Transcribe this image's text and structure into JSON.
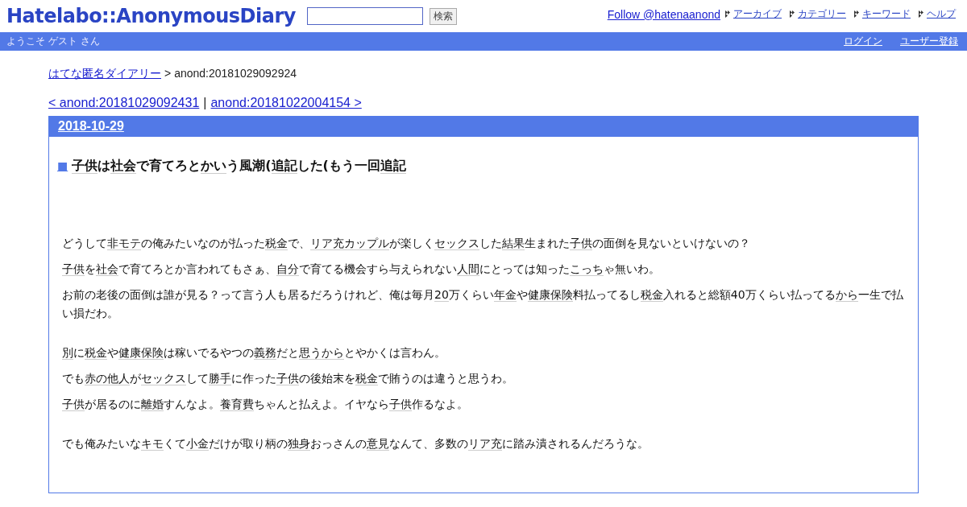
{
  "header": {
    "logo": "Hatelabo::AnonymousDiary",
    "search": {
      "button": "検索"
    },
    "follow": "Follow @hatenaanond",
    "nav": [
      "アーカイブ",
      "カテゴリー",
      "キーワード",
      "ヘルプ"
    ]
  },
  "userbar": {
    "welcome": "ようこそ ゲスト さん",
    "links": [
      "ログイン",
      "ユーザー登録"
    ]
  },
  "breadcrumb": {
    "home": "はてな匿名ダイアリー",
    "separator": ">",
    "current": "anond:20181029092924"
  },
  "pager": {
    "prev": "< anond:20181029092431",
    "separator": "|",
    "next": "anond:20181022004154 >"
  },
  "entry": {
    "date": "2018-10-29",
    "mark": "■",
    "title": [
      {
        "text": "子供",
        "keyword": true
      },
      {
        "text": "は",
        "keyword": false
      },
      {
        "text": "社会",
        "keyword": true
      },
      {
        "text": "で育てろと",
        "keyword": false
      },
      {
        "text": "かい",
        "keyword": true
      },
      {
        "text": "う風潮(",
        "keyword": false
      },
      {
        "text": "追記",
        "keyword": true
      },
      {
        "text": "した(もう一回",
        "keyword": false
      },
      {
        "text": "追記",
        "keyword": true
      }
    ],
    "sections": [
      [
        [
          {
            "text": "どうして",
            "keyword": false
          },
          {
            "text": "非モテ",
            "keyword": true
          },
          {
            "text": "の俺みたいなのが払った",
            "keyword": false
          },
          {
            "text": "税金",
            "keyword": true
          },
          {
            "text": "で、",
            "keyword": false
          },
          {
            "text": "リア充カップル",
            "keyword": true
          },
          {
            "text": "が楽しく",
            "keyword": false
          },
          {
            "text": "セックス",
            "keyword": true
          },
          {
            "text": "した",
            "keyword": false
          },
          {
            "text": "結果",
            "keyword": true
          },
          {
            "text": "生まれた",
            "keyword": false
          },
          {
            "text": "子供",
            "keyword": true
          },
          {
            "text": "の面倒を見ないといけないの？",
            "keyword": false
          }
        ],
        [
          {
            "text": "子供",
            "keyword": true
          },
          {
            "text": "を",
            "keyword": false
          },
          {
            "text": "社会",
            "keyword": true
          },
          {
            "text": "で育てろとか言われてもさぁ、",
            "keyword": false
          },
          {
            "text": "自分",
            "keyword": true
          },
          {
            "text": "で育てる機会すら与えられない",
            "keyword": false
          },
          {
            "text": "人間",
            "keyword": true
          },
          {
            "text": "にとっては知った",
            "keyword": false
          },
          {
            "text": "こっち",
            "keyword": true
          },
          {
            "text": "ゃ無いわ。",
            "keyword": false
          }
        ],
        [
          {
            "text": "お前の老後の面倒は誰が見る？って言う人も居るだろうけれど、俺は毎月",
            "keyword": false
          },
          {
            "text": "20",
            "keyword": true
          },
          {
            "text": "万くらい",
            "keyword": false
          },
          {
            "text": "年金",
            "keyword": true
          },
          {
            "text": "や",
            "keyword": false
          },
          {
            "text": "健康保険",
            "keyword": true
          },
          {
            "text": "料払ってるし",
            "keyword": false
          },
          {
            "text": "税金",
            "keyword": true
          },
          {
            "text": "入れると総額40万くらい払ってる",
            "keyword": false
          },
          {
            "text": "から",
            "keyword": true
          },
          {
            "text": "一生で払い損だわ。",
            "keyword": false
          }
        ]
      ],
      [
        [
          {
            "text": "別",
            "keyword": true
          },
          {
            "text": "に",
            "keyword": false
          },
          {
            "text": "税金",
            "keyword": true
          },
          {
            "text": "や",
            "keyword": false
          },
          {
            "text": "健康保険",
            "keyword": true
          },
          {
            "text": "は稼いでるやつの",
            "keyword": false
          },
          {
            "text": "義務",
            "keyword": true
          },
          {
            "text": "だと",
            "keyword": false
          },
          {
            "text": "思うから",
            "keyword": true
          },
          {
            "text": "とやかくは言わん。",
            "keyword": false
          }
        ],
        [
          {
            "text": "でも",
            "keyword": false
          },
          {
            "text": "赤の他人",
            "keyword": true
          },
          {
            "text": "が",
            "keyword": false
          },
          {
            "text": "セックス",
            "keyword": true
          },
          {
            "text": "して",
            "keyword": false
          },
          {
            "text": "勝手",
            "keyword": true
          },
          {
            "text": "に作った",
            "keyword": false
          },
          {
            "text": "子供",
            "keyword": true
          },
          {
            "text": "の後始末を",
            "keyword": false
          },
          {
            "text": "税金",
            "keyword": true
          },
          {
            "text": "で賄うのは違うと思うわ。",
            "keyword": false
          }
        ],
        [
          {
            "text": "子供",
            "keyword": true
          },
          {
            "text": "が居るのに",
            "keyword": false
          },
          {
            "text": "離婚",
            "keyword": true
          },
          {
            "text": "すんなよ。",
            "keyword": false
          },
          {
            "text": "養育費",
            "keyword": true
          },
          {
            "text": "ちゃんと払えよ。イヤなら",
            "keyword": false
          },
          {
            "text": "子供",
            "keyword": true
          },
          {
            "text": "作るなよ。",
            "keyword": false
          }
        ]
      ],
      [
        [
          {
            "text": "でも俺みたいな",
            "keyword": false
          },
          {
            "text": "キモ",
            "keyword": true
          },
          {
            "text": "くて",
            "keyword": false
          },
          {
            "text": "小金",
            "keyword": true
          },
          {
            "text": "だけが取り柄の",
            "keyword": false
          },
          {
            "text": "独身",
            "keyword": true
          },
          {
            "text": "おっさんの",
            "keyword": false
          },
          {
            "text": "意見",
            "keyword": true
          },
          {
            "text": "なんて、多数の",
            "keyword": false
          },
          {
            "text": "リア充",
            "keyword": true
          },
          {
            "text": "に踏み潰されるんだろうな。",
            "keyword": false
          }
        ]
      ]
    ]
  }
}
